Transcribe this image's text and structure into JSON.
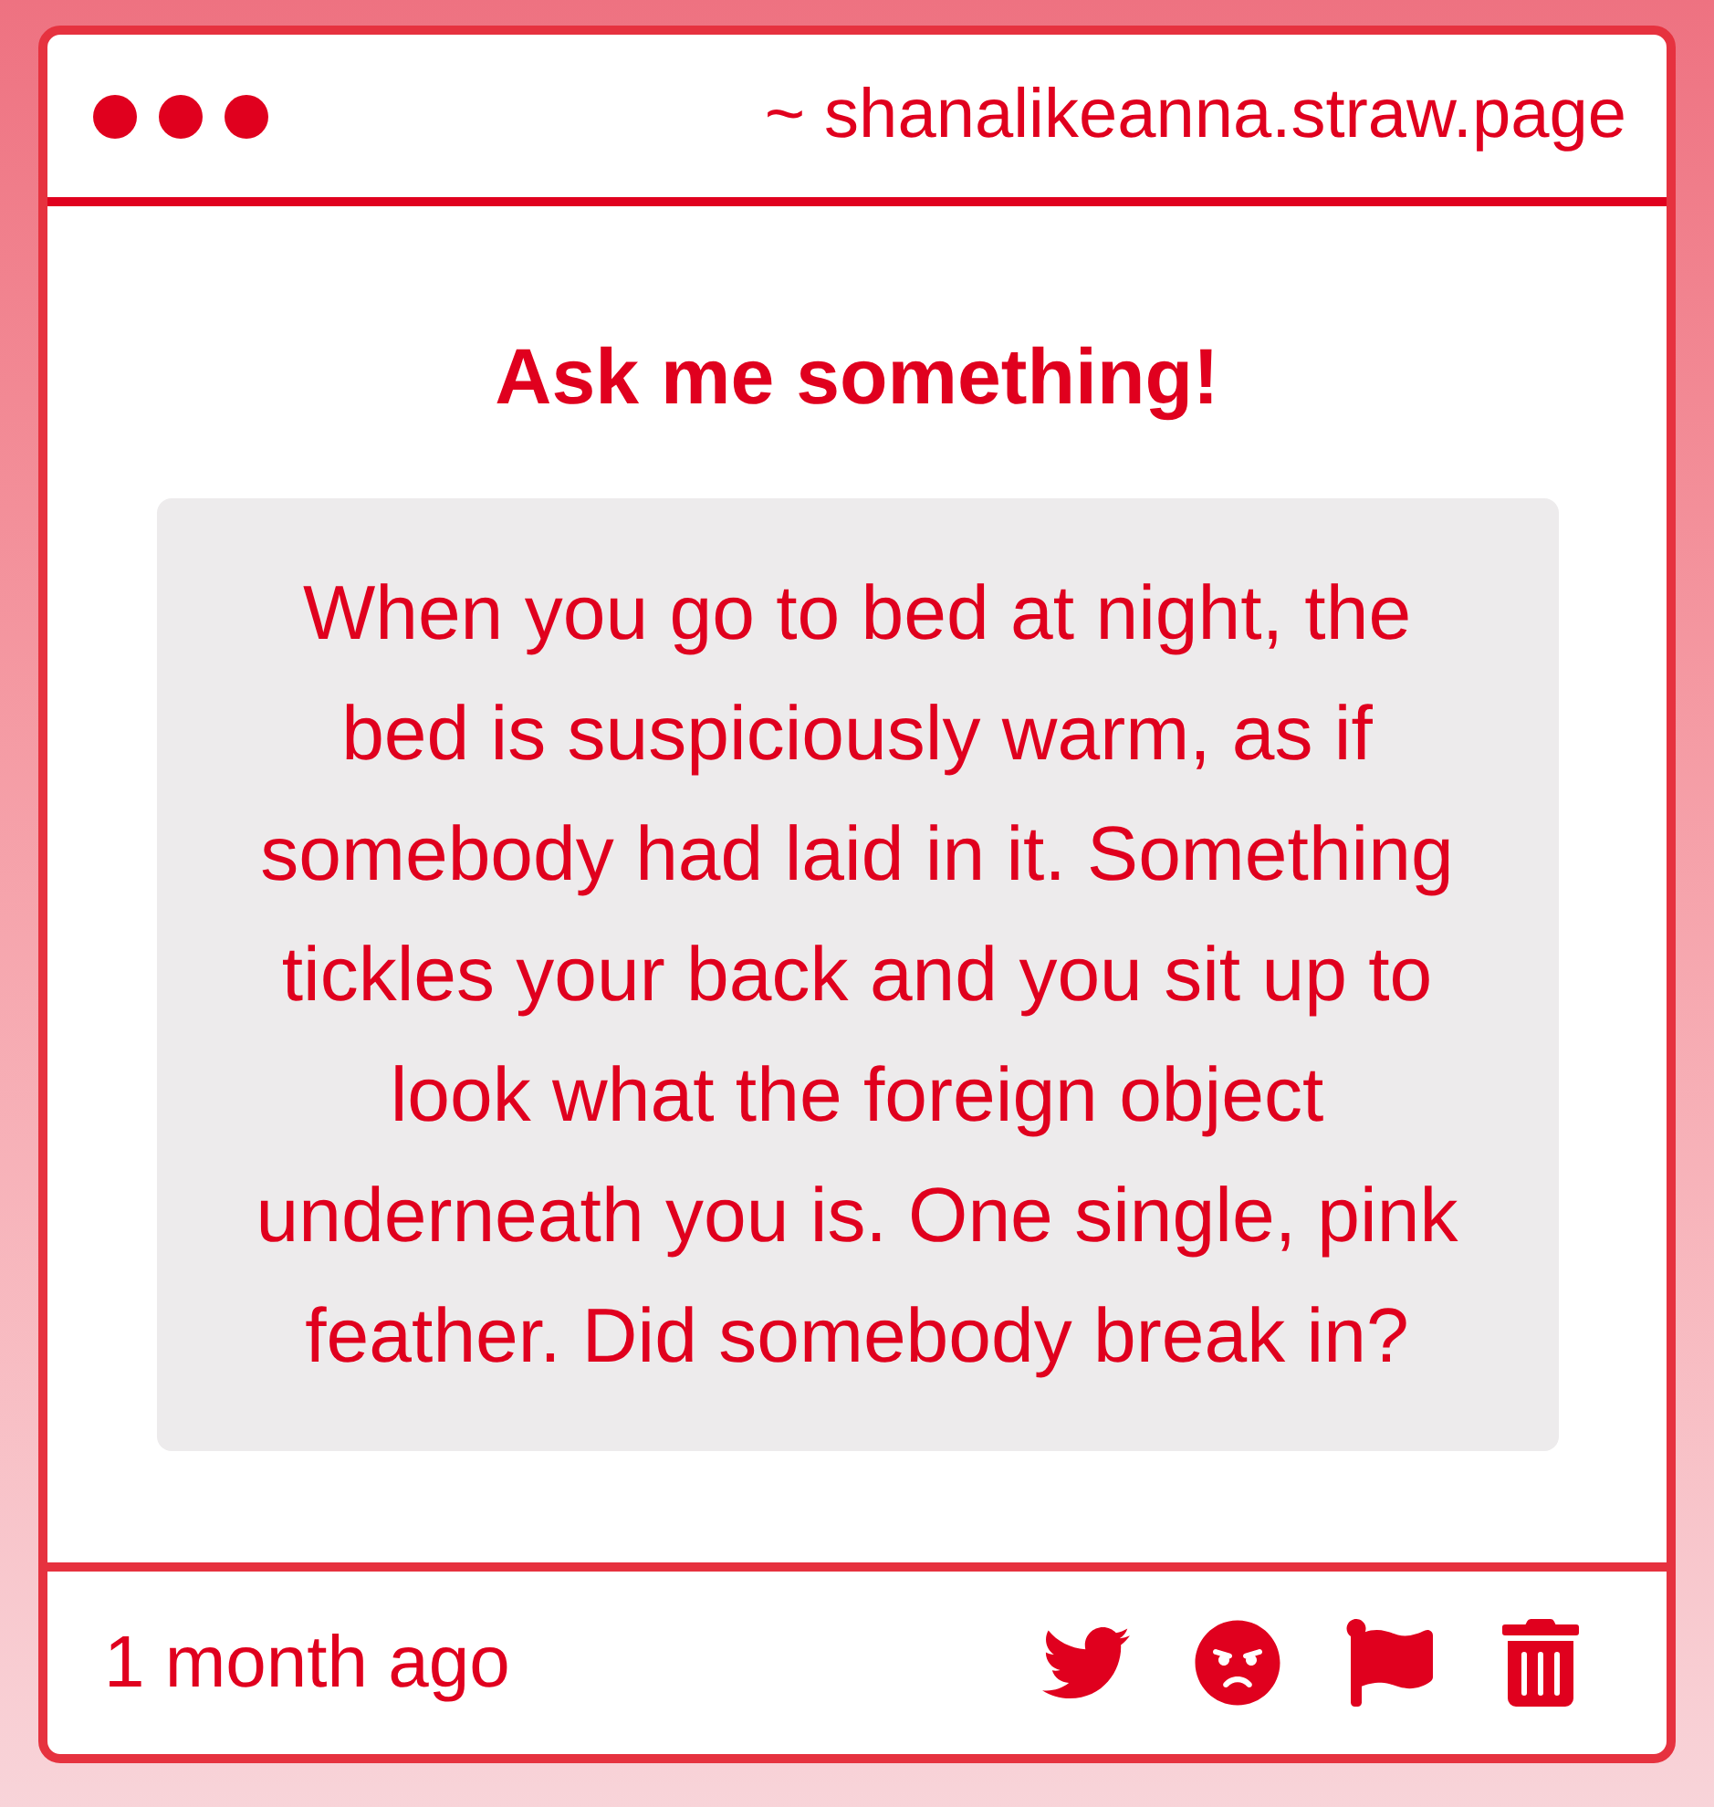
{
  "window": {
    "url": "~ shanalikeanna.straw.page"
  },
  "card": {
    "title": "Ask me something!",
    "question": "When you go to bed at night, the bed is suspiciously warm, as if somebody had laid in it. Something tickles your back and you sit up to look what the foreign object underneath you is. One single, pink feather. Did somebody break in?",
    "time": "1 month ago"
  },
  "actions": [
    {
      "kind": "twitter"
    },
    {
      "kind": "angry"
    },
    {
      "kind": "flag"
    },
    {
      "kind": "trash"
    }
  ]
}
